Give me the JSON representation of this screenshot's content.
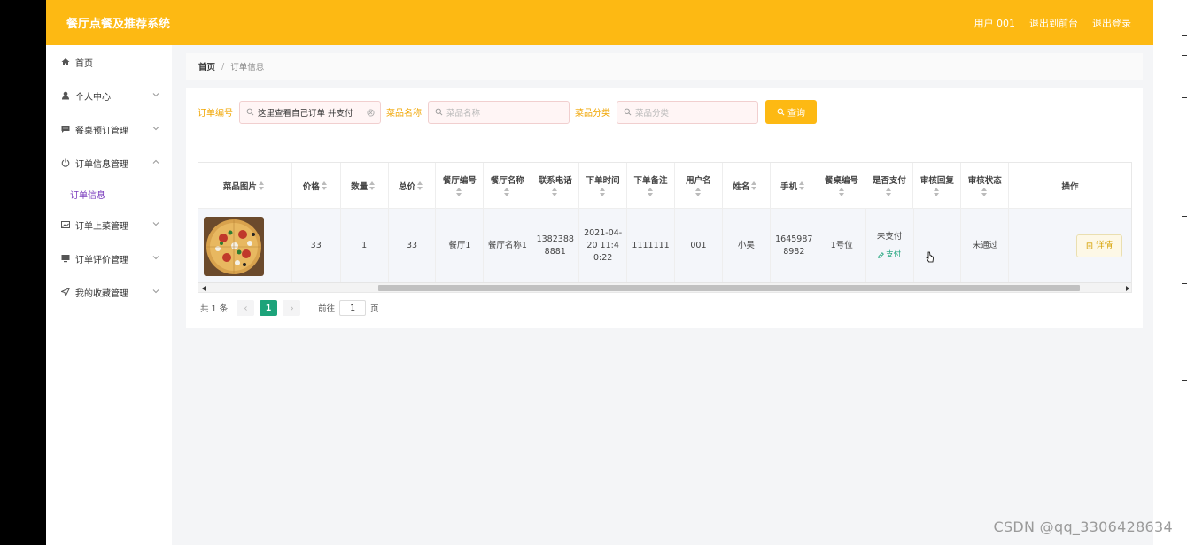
{
  "header": {
    "app_title": "餐厅点餐及推荐系统",
    "user_label": "用户 001",
    "back_to_front_label": "退出到前台",
    "logout_label": "退出登录",
    "brand_color": "#fdb913"
  },
  "sidebar": {
    "items": [
      {
        "label": "首页",
        "icon": "home-icon"
      },
      {
        "label": "个人中心",
        "icon": "user-icon"
      },
      {
        "label": "餐桌预订管理",
        "icon": "chat-icon"
      },
      {
        "label": "订单信息管理",
        "icon": "power-icon"
      },
      {
        "label": "订单上菜管理",
        "icon": "picture-icon"
      },
      {
        "label": "订单评价管理",
        "icon": "monitor-icon"
      },
      {
        "label": "我的收藏管理",
        "icon": "send-icon"
      }
    ],
    "subitem_label": "订单信息"
  },
  "breadcrumb": {
    "home": "首页",
    "separator": "/",
    "current": "订单信息"
  },
  "search": {
    "order_no_label": "订单编号",
    "order_no_value": "这里查看自己订单 并支付",
    "dish_name_label": "菜品名称",
    "dish_name_placeholder": "菜品名称",
    "dish_category_label": "菜品分类",
    "dish_category_placeholder": "菜品分类",
    "query_button": "查询"
  },
  "table": {
    "columns": [
      "菜品图片",
      "价格",
      "数量",
      "总价",
      "餐厅编号",
      "餐厅名称",
      "联系电话",
      "下单时间",
      "下单备注",
      "用户名",
      "姓名",
      "手机",
      "餐桌编号",
      "是否支付",
      "审核回复",
      "审核状态",
      "操作"
    ],
    "rows": [
      {
        "image": "pizza-image",
        "price": "33",
        "quantity": "1",
        "total": "33",
        "restaurant_no": "餐厅1",
        "restaurant_name": "餐厅名称1",
        "phone": "13823888881",
        "order_time": "2021-04-20 11:40:22",
        "order_note": "1111111",
        "username": "001",
        "name": "小吴",
        "mobile": "16459878982",
        "table_no": "1号位",
        "paid_status": "未支付",
        "pay_link": "支付",
        "review_reply": "",
        "review_status": "未通过",
        "detail_button": "详情"
      }
    ]
  },
  "pagination": {
    "total_text": "共 1 条",
    "current_page": "1",
    "goto_label": "前往",
    "goto_value": "1",
    "page_suffix": "页",
    "active_color": "#1ca37a"
  },
  "watermark": "CSDN @qq_3306428634"
}
